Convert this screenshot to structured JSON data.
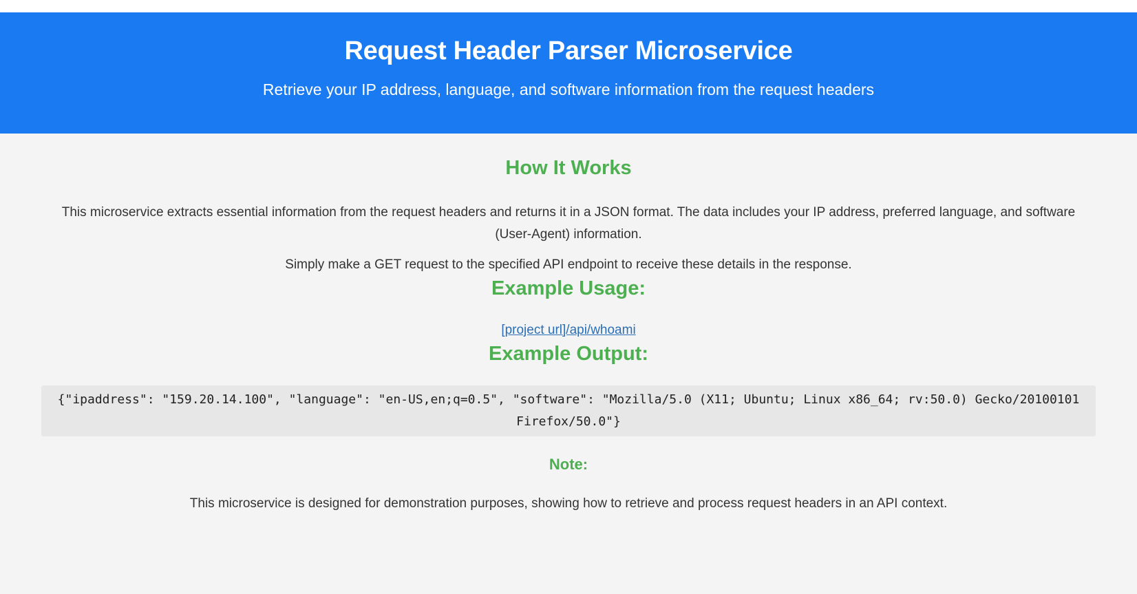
{
  "header": {
    "title": "Request Header Parser Microservice",
    "subtitle": "Retrieve your IP address, language, and software information from the request headers"
  },
  "how_it_works": {
    "title": "How It Works",
    "paragraph1": "This microservice extracts essential information from the request headers and returns it in a JSON format. The data includes your IP address, preferred language, and software (User-Agent) information.",
    "paragraph2": "Simply make a GET request to the specified API endpoint to receive these details in the response."
  },
  "example_usage": {
    "title": "Example Usage:",
    "link_text": "[project url]/api/whoami"
  },
  "example_output": {
    "title": "Example Output:",
    "code": "{\"ipaddress\": \"159.20.14.100\", \"language\": \"en-US,en;q=0.5\", \"software\": \"Mozilla/5.0 (X11; Ubuntu; Linux x86_64; rv:50.0) Gecko/20100101 Firefox/50.0\"}"
  },
  "note": {
    "title": "Note:",
    "text": "This microservice is designed for demonstration purposes, showing how to retrieve and process request headers in an API context."
  },
  "colors": {
    "header_bg": "#1a7af2",
    "accent_green": "#4caf50",
    "link": "#2a6fb5",
    "page_bg": "#f4f4f4"
  }
}
